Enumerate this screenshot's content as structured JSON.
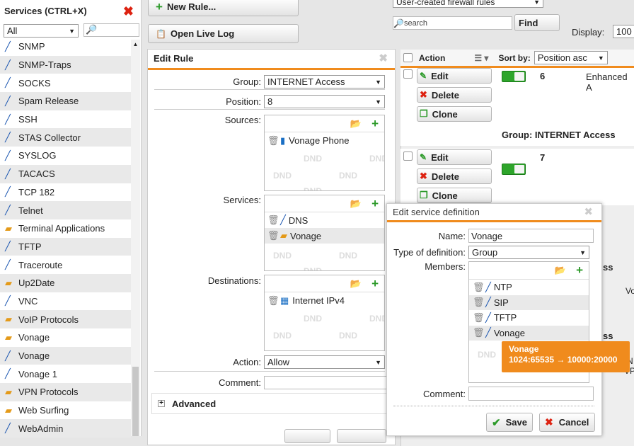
{
  "left": {
    "title": "Services (CTRL+X)",
    "filter_value": "All",
    "items": [
      {
        "label": "SNMP",
        "icon": "wire"
      },
      {
        "label": "SNMP-Traps",
        "icon": "wire"
      },
      {
        "label": "SOCKS",
        "icon": "wire"
      },
      {
        "label": "Spam Release",
        "icon": "wire"
      },
      {
        "label": "SSH",
        "icon": "wire"
      },
      {
        "label": "STAS Collector",
        "icon": "wire"
      },
      {
        "label": "SYSLOG",
        "icon": "wire"
      },
      {
        "label": "TACACS",
        "icon": "wire"
      },
      {
        "label": "TCP 182",
        "icon": "wire"
      },
      {
        "label": "Telnet",
        "icon": "wire"
      },
      {
        "label": "Terminal Applications",
        "icon": "group"
      },
      {
        "label": "TFTP",
        "icon": "wire"
      },
      {
        "label": "Traceroute",
        "icon": "wire"
      },
      {
        "label": "Up2Date",
        "icon": "group"
      },
      {
        "label": "VNC",
        "icon": "wire"
      },
      {
        "label": "VoIP Protocols",
        "icon": "group"
      },
      {
        "label": "Vonage",
        "icon": "group"
      },
      {
        "label": "Vonage",
        "icon": "wire"
      },
      {
        "label": "Vonage 1",
        "icon": "wire"
      },
      {
        "label": "VPN Protocols",
        "icon": "group"
      },
      {
        "label": "Web Surfing",
        "icon": "group"
      },
      {
        "label": "WebAdmin",
        "icon": "wire"
      }
    ]
  },
  "toolbar": {
    "new_rule": "New Rule...",
    "open_live_log": "Open Live Log",
    "filter_select": "User-created firewall rules",
    "search_placeholder": "search",
    "find": "Find",
    "display_label": "Display:",
    "display_value": "100"
  },
  "edit_rule": {
    "title": "Edit Rule",
    "group_label": "Group:",
    "group_value": "INTERNET Access",
    "position_label": "Position:",
    "position_value": "8",
    "sources_label": "Sources:",
    "sources": [
      "Vonage Phone"
    ],
    "services_label": "Services:",
    "services": [
      "DNS",
      "Vonage"
    ],
    "destinations_label": "Destinations:",
    "destinations": [
      "Internet IPv4"
    ],
    "action_label": "Action:",
    "action_value": "Allow",
    "comment_label": "Comment:",
    "advanced": "Advanced",
    "dnd": "DND"
  },
  "rules": {
    "action_header": "Action",
    "sortby_label": "Sort by:",
    "sortby_value": "Position asc",
    "edit": "Edit",
    "delete": "Delete",
    "clone": "Clone",
    "rule1_num": "6",
    "rule1_name": "Enhanced A",
    "group_line": "Group: INTERNET Access",
    "rule2_num": "7",
    "peek_ss1": "ss",
    "peek_ss2": "ss",
    "peek_vo": "Vo",
    "peek_n": "N",
    "peek_vp": "VP"
  },
  "service_def": {
    "title": "Edit service definition",
    "name_label": "Name:",
    "name_value": "Vonage",
    "type_label": "Type of definition:",
    "type_value": "Group",
    "members_label": "Members:",
    "members": [
      "NTP",
      "SIP",
      "TFTP",
      "Vonage"
    ],
    "comment_label": "Comment:",
    "save": "Save",
    "cancel": "Cancel",
    "tooltip_title": "Vonage",
    "tooltip_body": "1024:65535 → 10000:20000"
  }
}
